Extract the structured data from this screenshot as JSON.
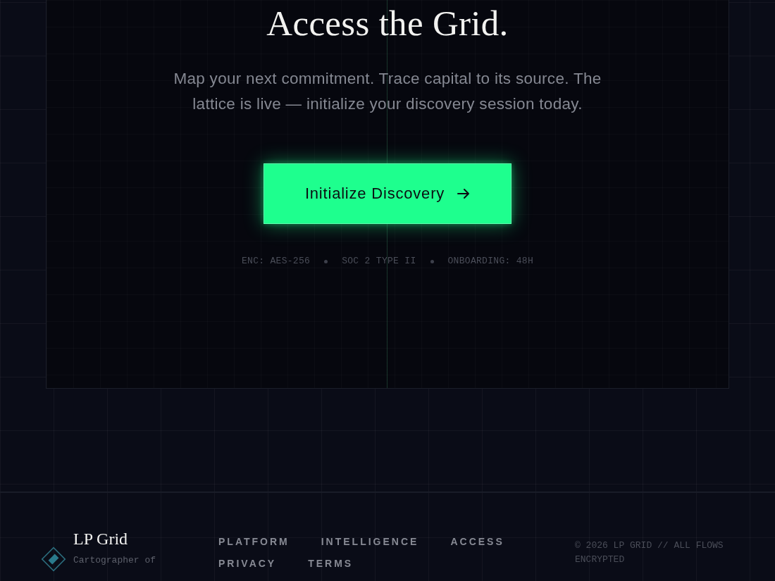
{
  "hero": {
    "title": "Access the Grid.",
    "description": "Map your next commitment. Trace capital to its source. The lattice is live — initialize your discovery session today.",
    "cta": {
      "label": "Initialize Discovery"
    },
    "meta": [
      "ENC: AES-256",
      "SOC 2 TYPE II",
      "ONBOARDING: 48H"
    ]
  },
  "footer": {
    "brand": {
      "name": "LP Grid",
      "tagline": "Cartographer of"
    },
    "links": [
      "PLATFORM",
      "INTELLIGENCE",
      "ACCESS",
      "PRIVACY",
      "TERMS"
    ],
    "copyright": "© 2026 LP GRID // ALL FLOWS ENCRYPTED"
  }
}
